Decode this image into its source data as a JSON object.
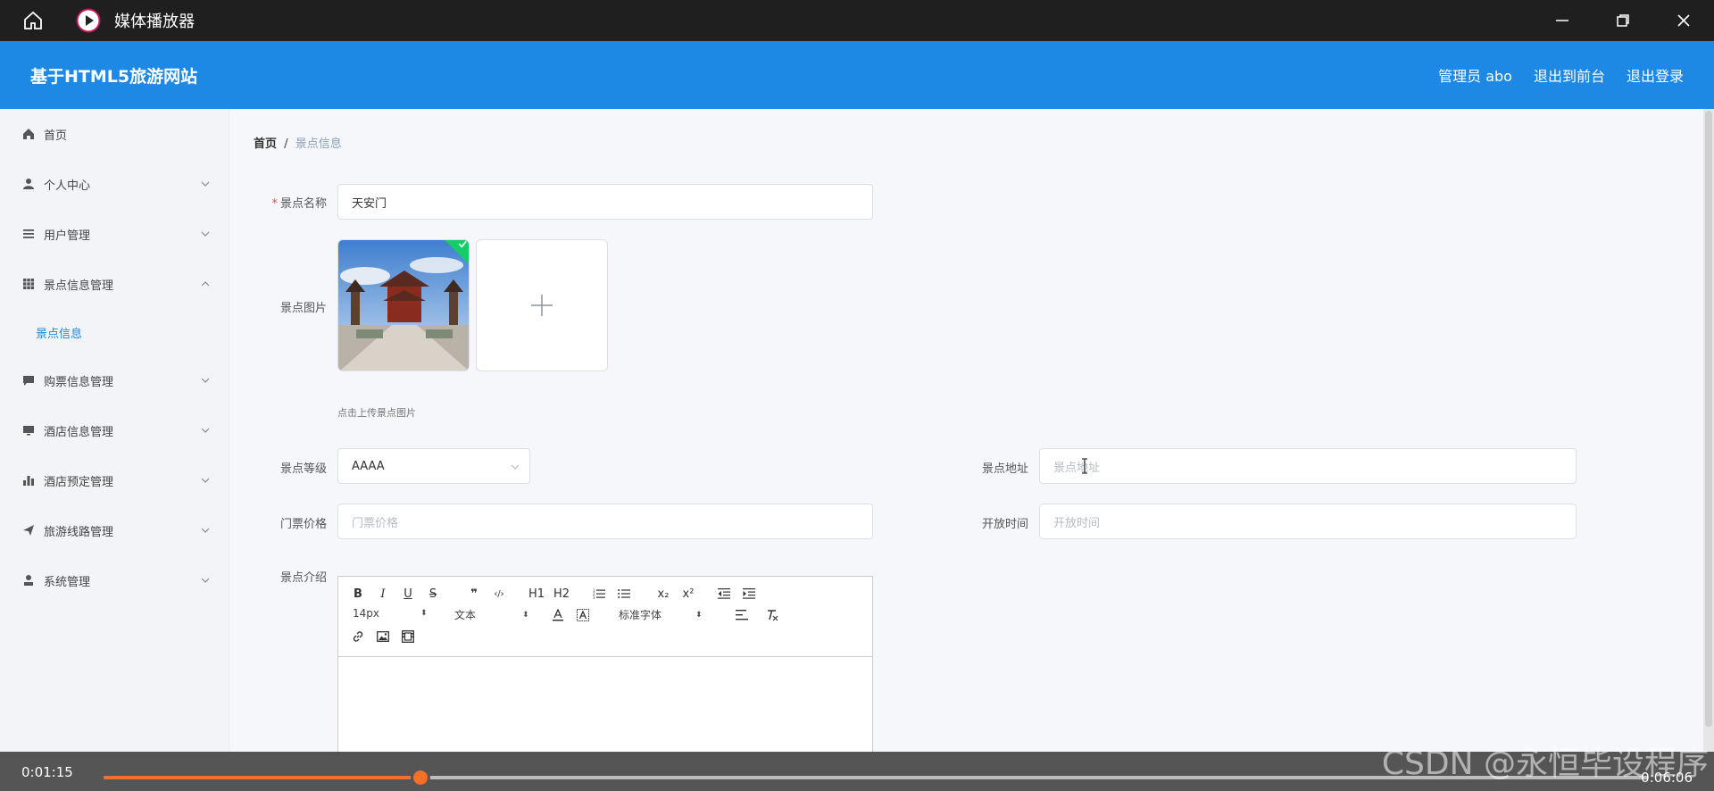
{
  "player": {
    "title": "媒体播放器",
    "time_elapsed": "0:01:15",
    "time_total": "0:06:06",
    "progress_fraction": 0.205,
    "accent_color": "#f36f2a"
  },
  "header": {
    "site_title": "基于HTML5旅游网站",
    "admin_label": "管理员 abo",
    "to_frontend": "退出到前台",
    "logout": "退出登录",
    "brand_color": "#1e88e5"
  },
  "sidebar": {
    "items": [
      {
        "label": "首页",
        "icon": "home-icon"
      },
      {
        "label": "个人中心",
        "icon": "user-icon"
      },
      {
        "label": "用户管理",
        "icon": "list-icon"
      },
      {
        "label": "景点信息管理",
        "icon": "grid-icon"
      },
      {
        "label": "购票信息管理",
        "icon": "chat-icon"
      },
      {
        "label": "酒店信息管理",
        "icon": "monitor-icon"
      },
      {
        "label": "酒店预定管理",
        "icon": "bar-chart-icon"
      },
      {
        "label": "旅游线路管理",
        "icon": "send-icon"
      },
      {
        "label": "系统管理",
        "icon": "person-icon"
      }
    ],
    "sub_item": "景点信息"
  },
  "breadcrumb": {
    "home": "首页",
    "separator": "/",
    "current": "景点信息"
  },
  "form": {
    "name_label": "景点名称",
    "name_value": "天安门",
    "image_label": "景点图片",
    "upload_tip": "点击上传景点图片",
    "level_label": "景点等级",
    "level_value": "AAAA",
    "address_label": "景点地址",
    "address_placeholder": "景点地址",
    "price_label": "门票价格",
    "price_placeholder": "门票价格",
    "open_label": "开放时间",
    "open_placeholder": "开放时间",
    "intro_label": "景点介绍"
  },
  "editor": {
    "font_size": "14px",
    "paragraph": "文本",
    "font_family": "标准字体",
    "buttons": {
      "bold": "B",
      "italic": "I",
      "underline": "U",
      "strike": "S",
      "quote": "❞",
      "code": "‹/›",
      "h1": "H1",
      "h2": "H2",
      "sub": "x₂",
      "sup": "x²"
    }
  },
  "watermark": "CSDN @永恒毕设程序"
}
